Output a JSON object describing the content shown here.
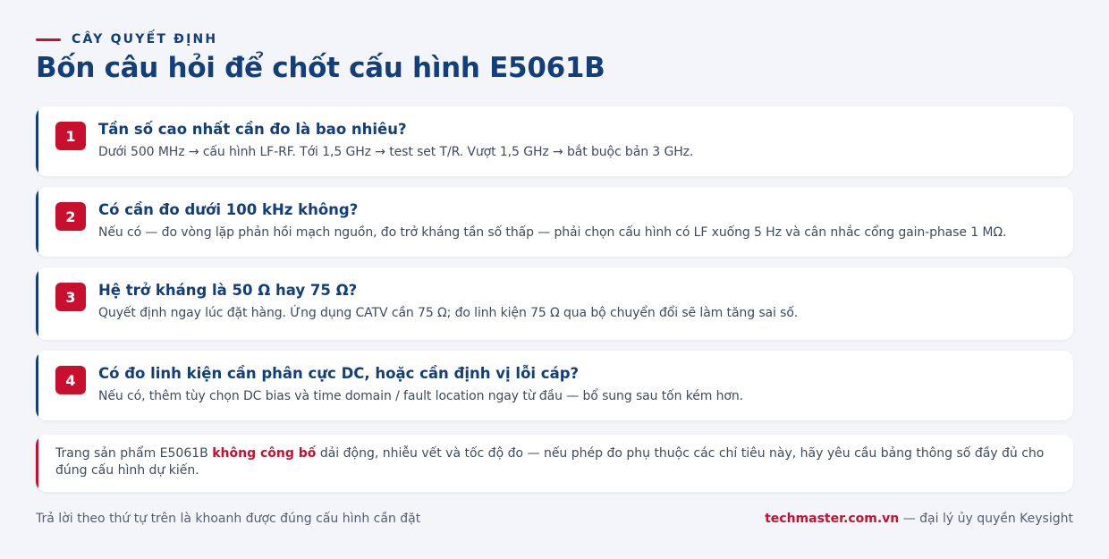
{
  "header": {
    "eyebrow": "CÂY QUYẾT ĐỊNH",
    "title": "Bốn câu hỏi để chốt cấu hình E5061B"
  },
  "questions": [
    {
      "number": "1",
      "title": "Tần số cao nhất cần đo là bao nhiêu?",
      "description": "Dưới 500 MHz → cấu hình LF-RF. Tới 1,5 GHz → test set T/R. Vượt 1,5 GHz → bắt buộc bản 3 GHz."
    },
    {
      "number": "2",
      "title": "Có cần đo dưới 100 kHz không?",
      "description": "Nếu có — đo vòng lặp phản hồi mạch nguồn, đo trở kháng tần số thấp — phải chọn cấu hình có LF xuống 5 Hz và cân nhắc cổng gain-phase 1 MΩ."
    },
    {
      "number": "3",
      "title": "Hệ trở kháng là 50 Ω hay 75 Ω?",
      "description": "Quyết định ngay lúc đặt hàng. Ứng dụng CATV cần 75 Ω; đo linh kiện 75 Ω qua bộ chuyển đổi sẽ làm tăng sai số."
    },
    {
      "number": "4",
      "title": "Có đo linh kiện cần phân cực DC, hoặc cần định vị lỗi cáp?",
      "description": "Nếu có, thêm tùy chọn DC bias và time domain / fault location ngay từ đầu — bổ sung sau tốn kém hơn."
    }
  ],
  "note": {
    "prefix": "Trang sản phẩm E5061B ",
    "emphasis": "không công bố",
    "suffix": " dải động, nhiễu vết và tốc độ đo — nếu phép đo phụ thuộc các chỉ tiêu này, hãy yêu cầu bảng thông số đầy đủ cho đúng cấu hình dự kiến."
  },
  "footer": {
    "left": "Trả lời theo thứ tự trên là khoanh được đúng cấu hình cần đặt",
    "brand": "techmaster.com.vn",
    "right_suffix": " — đại lý ủy quyền Keysight"
  },
  "colors": {
    "navy": "#123f7a",
    "accent_red": "#c8102e",
    "background": "#f4f5f8"
  }
}
